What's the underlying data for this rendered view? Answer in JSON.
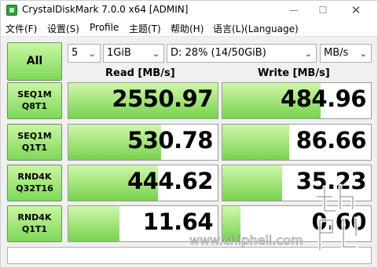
{
  "window": {
    "title": "CrystalDiskMark 7.0.0 x64 [ADMIN]",
    "controls": {
      "minimize": "—",
      "maximize": "☐",
      "close": "✕"
    }
  },
  "menu": {
    "file": "文件(F)",
    "settings": "设置(S)",
    "profile": "Profile",
    "theme": "主题(T)",
    "help": "帮助(H)",
    "language": "语言(L)(Language)"
  },
  "controls": {
    "all_label": "All",
    "count": "5",
    "size": "1GiB",
    "drive": "D: 28% (14/50GiB)",
    "unit": "MB/s"
  },
  "headers": {
    "read": "Read [MB/s]",
    "write": "Write [MB/s]"
  },
  "tests": [
    {
      "line1": "SEQ1M",
      "line2": "Q8T1",
      "read": "2550.97",
      "write": "484.96",
      "read_fill": 1.0,
      "write_fill": 0.66
    },
    {
      "line1": "SEQ1M",
      "line2": "Q1T1",
      "read": "530.78",
      "write": "86.66",
      "read_fill": 0.62,
      "write_fill": 0.45
    },
    {
      "line1": "RND4K",
      "line2": "Q32T16",
      "read": "444.62",
      "write": "35.23",
      "read_fill": 0.6,
      "write_fill": 0.4
    },
    {
      "line1": "RND4K",
      "line2": "Q1T1",
      "read": "11.64",
      "write": "0.60",
      "read_fill": 0.34,
      "write_fill": 0.12
    }
  ],
  "comment": "",
  "watermark": {
    "url": "www.chiphell.com"
  },
  "colors": {
    "accent_green": "#7ed858",
    "bar_light": "#cff8aa",
    "border": "#9c9c9c"
  }
}
